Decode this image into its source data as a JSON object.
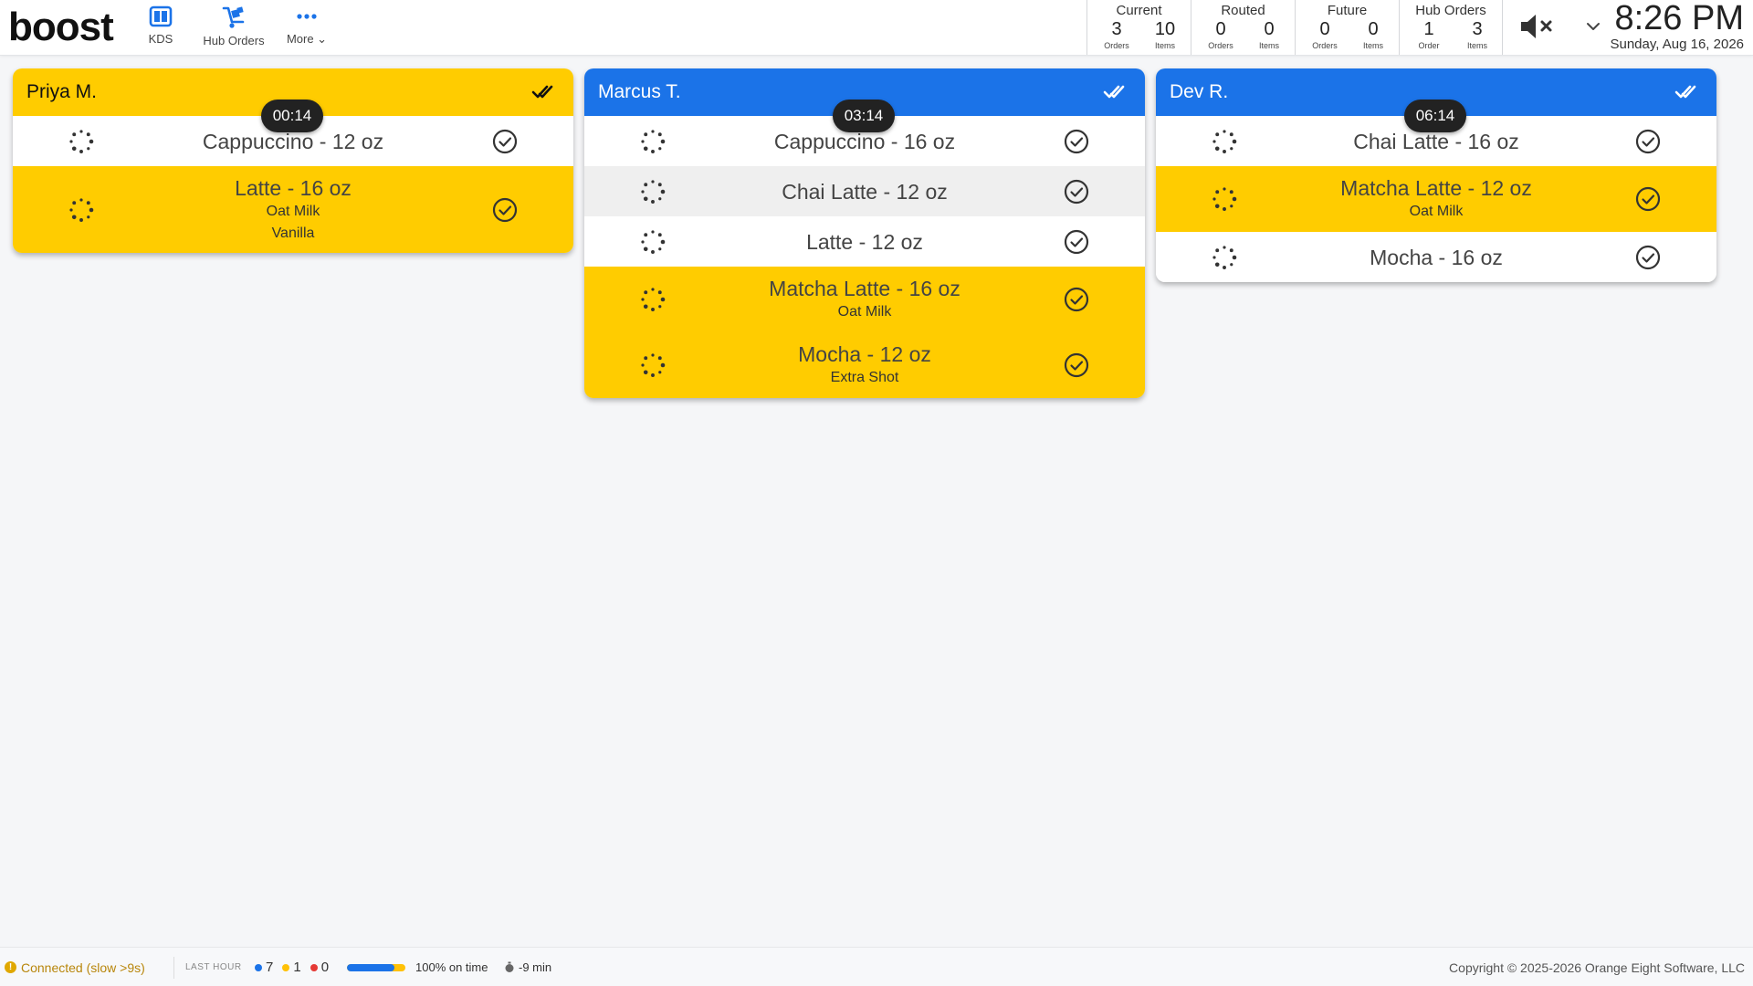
{
  "app": {
    "logo": "boost"
  },
  "nav": {
    "kds": {
      "label": "KDS",
      "icon": "kds-layout-icon"
    },
    "hub": {
      "label": "Hub Orders",
      "icon": "dolly-icon"
    },
    "more": {
      "label": "More ⌄",
      "icon": "more-dots-icon"
    }
  },
  "stats": {
    "current": {
      "title": "Current",
      "orders": "3",
      "orders_label": "Orders",
      "items": "10",
      "items_label": "Items"
    },
    "routed": {
      "title": "Routed",
      "orders": "0",
      "orders_label": "Orders",
      "items": "0",
      "items_label": "Items"
    },
    "future": {
      "title": "Future",
      "orders": "0",
      "orders_label": "Orders",
      "items": "0",
      "items_label": "Items"
    },
    "hub": {
      "title": "Hub Orders",
      "orders": "1",
      "orders_label": "Order",
      "items": "3",
      "items_label": "Items"
    }
  },
  "sound": {
    "icon": "speaker-muted-icon"
  },
  "clock": {
    "time": "8:26 PM",
    "date": "Sunday, Aug 16, 2026"
  },
  "colors": {
    "yellow": "#ffcc00",
    "blue": "#1b73e8",
    "timer_bg": "#222222"
  },
  "orders": [
    {
      "customer": "Priya M.",
      "timer": "00:14",
      "header_color": "yellow",
      "items": [
        {
          "name": "Cappuccino - 12 oz",
          "modifiers": [],
          "bg": "white"
        },
        {
          "name": "Latte - 16 oz",
          "modifiers": [
            "Oat Milk",
            "Vanilla"
          ],
          "bg": "yellow"
        }
      ]
    },
    {
      "customer": "Marcus T.",
      "timer": "03:14",
      "header_color": "blue",
      "items": [
        {
          "name": "Cappuccino - 16 oz",
          "modifiers": [],
          "bg": "white"
        },
        {
          "name": "Chai Latte - 12 oz",
          "modifiers": [],
          "bg": "grey"
        },
        {
          "name": "Latte - 12 oz",
          "modifiers": [],
          "bg": "white"
        },
        {
          "name": "Matcha Latte - 16 oz",
          "modifiers": [
            "Oat Milk"
          ],
          "bg": "yellow"
        },
        {
          "name": "Mocha - 12 oz",
          "modifiers": [
            "Extra Shot"
          ],
          "bg": "yellow"
        }
      ]
    },
    {
      "customer": "Dev R.",
      "timer": "06:14",
      "header_color": "blue",
      "items": [
        {
          "name": "Chai Latte - 16 oz",
          "modifiers": [],
          "bg": "white"
        },
        {
          "name": "Matcha Latte - 12 oz",
          "modifiers": [
            "Oat Milk"
          ],
          "bg": "yellow"
        },
        {
          "name": "Mocha - 16 oz",
          "modifiers": [],
          "bg": "white"
        }
      ]
    }
  ],
  "footer": {
    "connection": "Connected (slow >9s)",
    "last_hour_label": "LAST HOUR",
    "count_blue": "7",
    "count_yellow": "1",
    "count_red": "0",
    "on_time_fraction": 0.82,
    "on_time": "100% on time",
    "avg_time": "-9 min",
    "copyright": "Copyright © 2025-2026 Orange Eight Software, LLC"
  }
}
